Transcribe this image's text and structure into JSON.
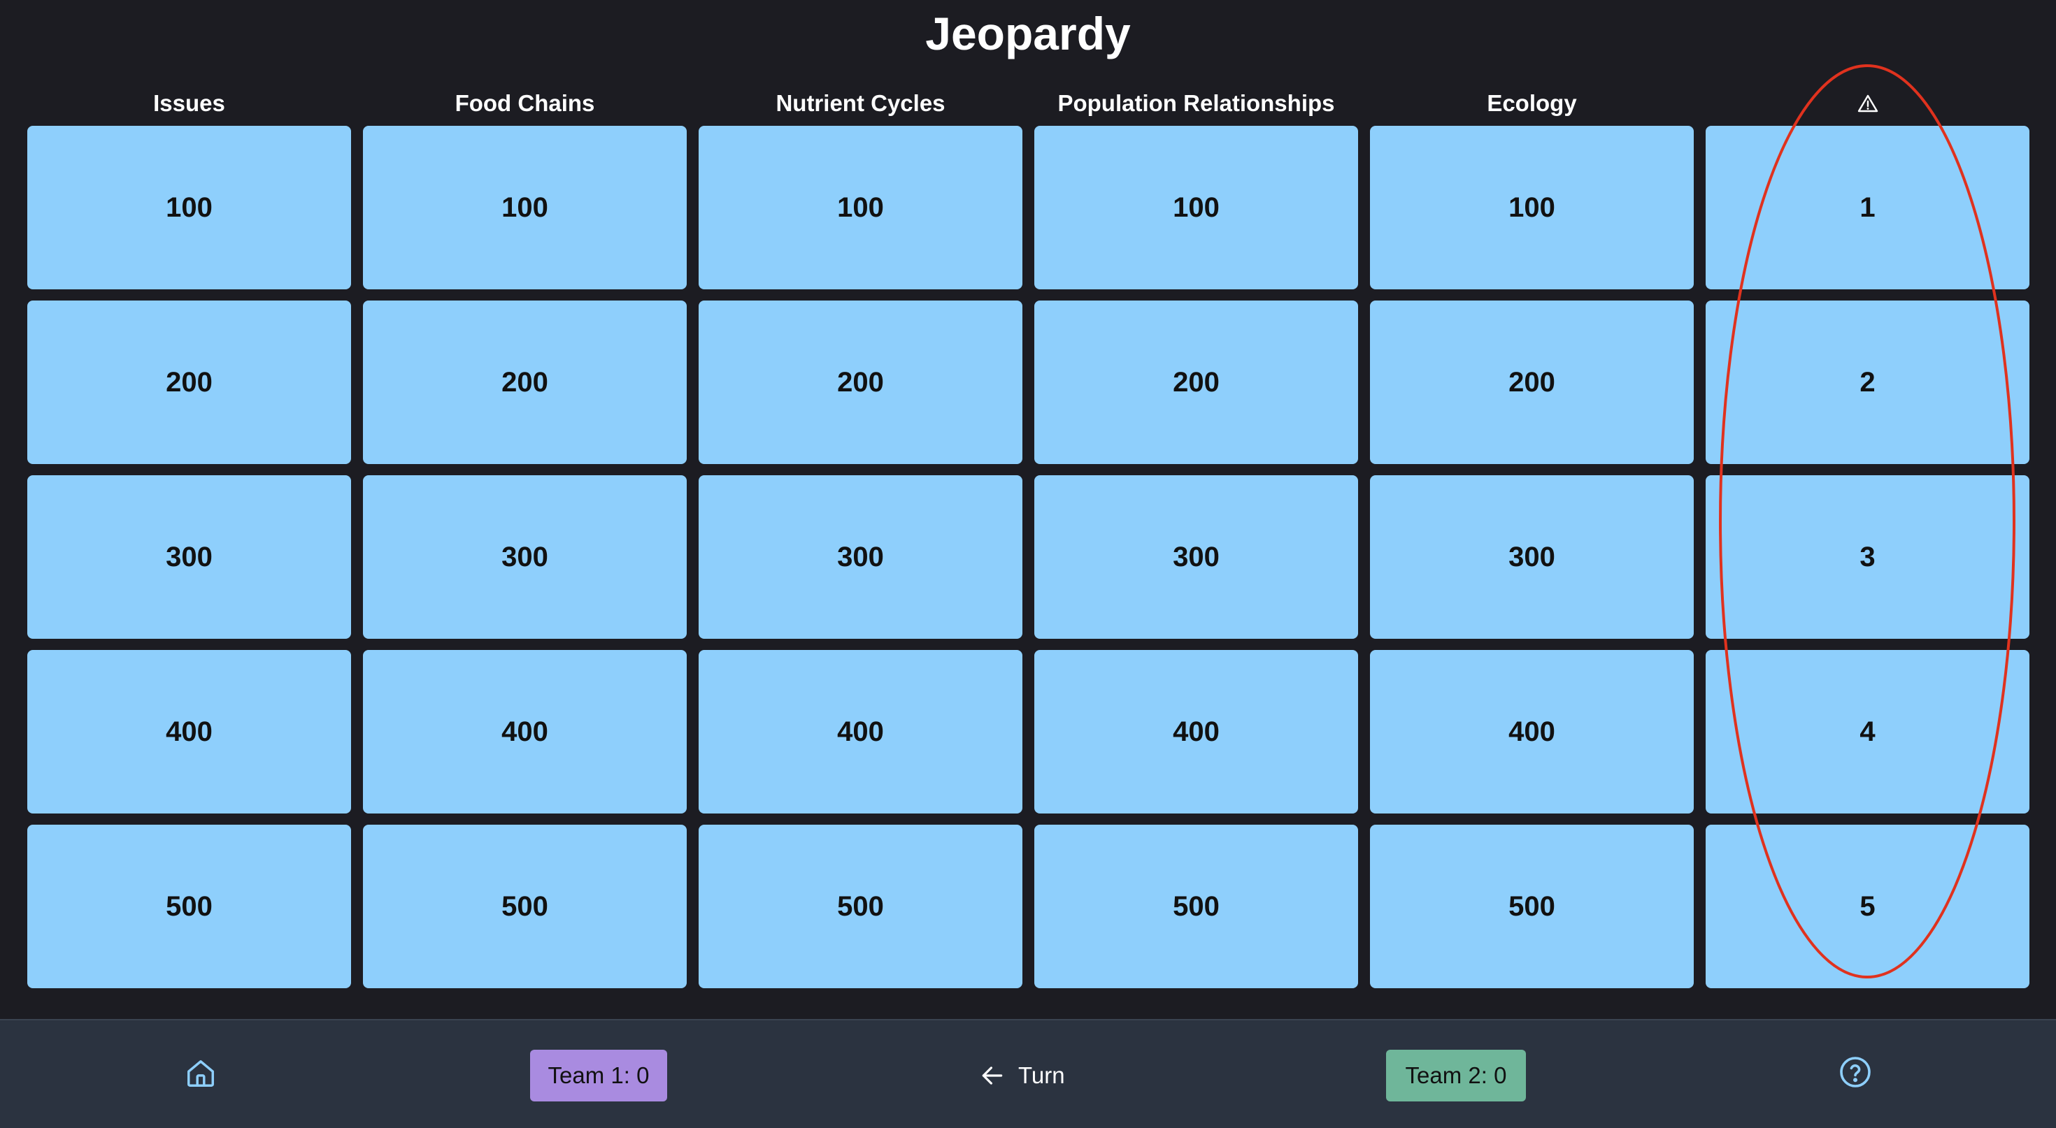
{
  "app": {
    "title": "Jeopardy"
  },
  "board": {
    "categories": [
      {
        "label": "Issues"
      },
      {
        "label": "Food Chains"
      },
      {
        "label": "Nutrient Cycles"
      },
      {
        "label": "Population Relationships"
      },
      {
        "label": "Ecology"
      },
      {
        "label": "",
        "icon": "warning-icon"
      }
    ],
    "rows": [
      [
        "100",
        "100",
        "100",
        "100",
        "100",
        "1"
      ],
      [
        "200",
        "200",
        "200",
        "200",
        "200",
        "2"
      ],
      [
        "300",
        "300",
        "300",
        "300",
        "300",
        "3"
      ],
      [
        "400",
        "400",
        "400",
        "400",
        "400",
        "4"
      ],
      [
        "500",
        "500",
        "500",
        "500",
        "500",
        "5"
      ]
    ]
  },
  "footer": {
    "home_icon": "home-icon",
    "team1": "Team 1: 0",
    "turn_icon": "arrow-left-icon",
    "turn_label": "Turn",
    "team2": "Team 2: 0",
    "help_icon": "help-circle-icon"
  },
  "colors": {
    "background": "#1c1c22",
    "tile": "#8ecffc",
    "footer": "#2b3340",
    "team1": "#a98be0",
    "team2": "#6fb69a",
    "annotation": "#e0321e",
    "icon": "#8ecffc"
  }
}
